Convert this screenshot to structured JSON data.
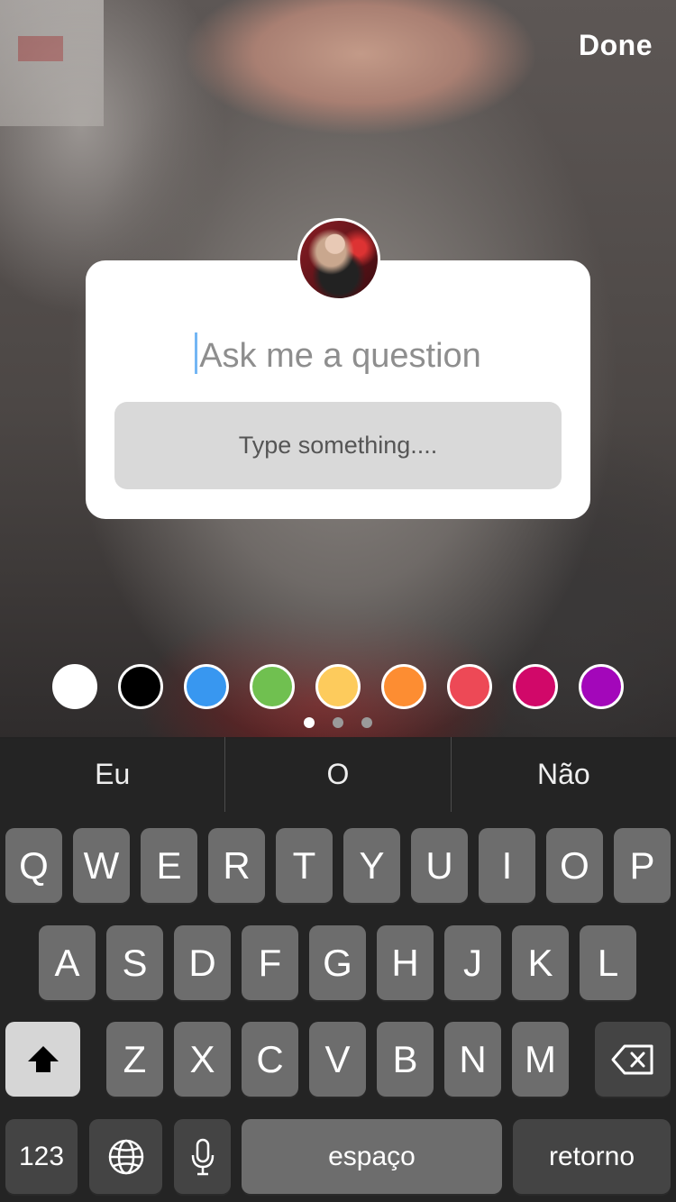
{
  "header": {
    "done_label": "Done"
  },
  "sticker": {
    "question_placeholder": "Ask me a question",
    "answer_placeholder": "Type something...."
  },
  "color_picker": {
    "swatches": [
      "#ffffff",
      "#000000",
      "#3897f0",
      "#70c050",
      "#fdcb5c",
      "#fd8d32",
      "#ed4956",
      "#d10869",
      "#a307ba"
    ],
    "page_count": 3,
    "active_page": 1
  },
  "keyboard": {
    "suggestions": [
      "Eu",
      "O",
      "Não"
    ],
    "row1": [
      "Q",
      "W",
      "E",
      "R",
      "T",
      "Y",
      "U",
      "I",
      "O",
      "P"
    ],
    "row2": [
      "A",
      "S",
      "D",
      "F",
      "G",
      "H",
      "J",
      "K",
      "L"
    ],
    "row3": [
      "Z",
      "X",
      "C",
      "V",
      "B",
      "N",
      "M"
    ],
    "numbers_label": "123",
    "space_label": "espaço",
    "return_label": "retorno"
  }
}
